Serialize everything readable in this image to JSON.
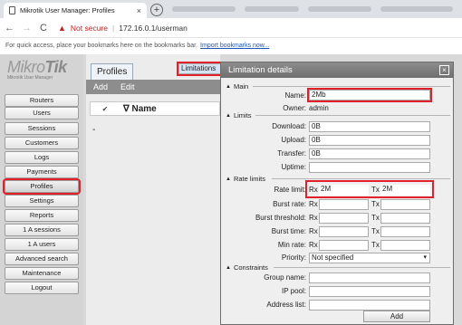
{
  "browser": {
    "tab_title": "Mikrotik User Manager: Profiles",
    "tab_close": "×",
    "new_tab": "+",
    "back": "←",
    "forward": "→",
    "reload": "C",
    "warn_icon": "▲",
    "security_text": "Not secure",
    "url": "172.16.0.1/userman",
    "bookmark_text": "For quick access, place your bookmarks here on the bookmarks bar.",
    "bookmark_link": "Import bookmarks now..."
  },
  "logo": {
    "brand_a": "Mikro",
    "brand_b": "Tik",
    "subtitle": "Mikrotik User Manager"
  },
  "nav": [
    "Routers",
    "Users",
    "Sessions",
    "Customers",
    "Logs",
    "Payments",
    "Profiles",
    "Settings",
    "Reports",
    "1 A sessions",
    "1 A users",
    "Advanced search",
    "Maintenance",
    "Logout"
  ],
  "nav_active": "Profiles",
  "tabs": {
    "profiles": "Profiles",
    "limitations": "Limitations"
  },
  "toolbar": {
    "add": "Add",
    "edit": "Edit"
  },
  "grid": {
    "check": "✔",
    "name_header": "∇ Name",
    "row_mark": "-"
  },
  "dialog": {
    "title": "Limitation details",
    "close": "×",
    "main": {
      "section": "Main",
      "name_label": "Name:",
      "name_value": "2Mb",
      "owner_label": "Owner:",
      "owner_value": "admin"
    },
    "limits": {
      "section": "Limits",
      "download_label": "Download:",
      "download_value": "0B",
      "upload_label": "Upload:",
      "upload_value": "0B",
      "transfer_label": "Transfer:",
      "transfer_value": "0B",
      "uptime_label": "Uptime:",
      "uptime_value": ""
    },
    "rate_limits": {
      "section": "Rate limits",
      "rx": "Rx",
      "tx": "Tx",
      "rate_limit_label": "Rate limit:",
      "rate_limit_rx": "2M",
      "rate_limit_tx": "2M",
      "burst_rate_label": "Burst rate:",
      "burst_threshold_label": "Burst threshold:",
      "burst_time_label": "Burst time:",
      "min_rate_label": "Min rate:",
      "priority_label": "Priority:",
      "priority_value": "Not specified",
      "priority_arrow": "▾"
    },
    "constraints": {
      "section": "Constraints",
      "group_label": "Group name:",
      "ip_pool_label": "IP pool:",
      "address_list_label": "Address list:"
    },
    "add_button": "Add"
  }
}
